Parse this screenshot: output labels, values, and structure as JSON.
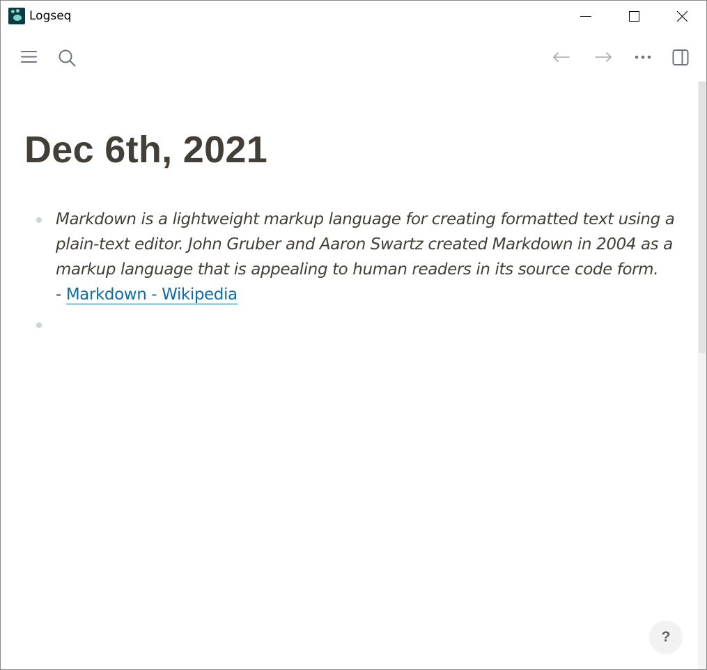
{
  "window": {
    "title": "Logseq",
    "controls": {
      "minimize": "minimize",
      "maximize": "maximize",
      "close": "close"
    }
  },
  "toolbar": {
    "left": [
      "menu-icon",
      "search-icon"
    ],
    "right": [
      "back-arrow-icon",
      "forward-arrow-icon",
      "more-icon",
      "right-sidebar-icon"
    ]
  },
  "page": {
    "title": "Dec 6th, 2021",
    "blocks": [
      {
        "text": "Markdown is a lightweight markup language for creating formatted text using a plain-text editor. John Gruber and Aaron Swartz created Markdown in 2004 as a markup language that is appealing to human readers in its source code form.",
        "dash": "- ",
        "link": "Markdown - Wikipedia"
      },
      {
        "text": ""
      }
    ]
  },
  "help": {
    "label": "?"
  },
  "colors": {
    "title": "#433f38",
    "link": "#106ba3",
    "bullet": "#ced4d6",
    "logo_bg": "#0b3a42",
    "logo_fg": "#7fd1c8"
  }
}
